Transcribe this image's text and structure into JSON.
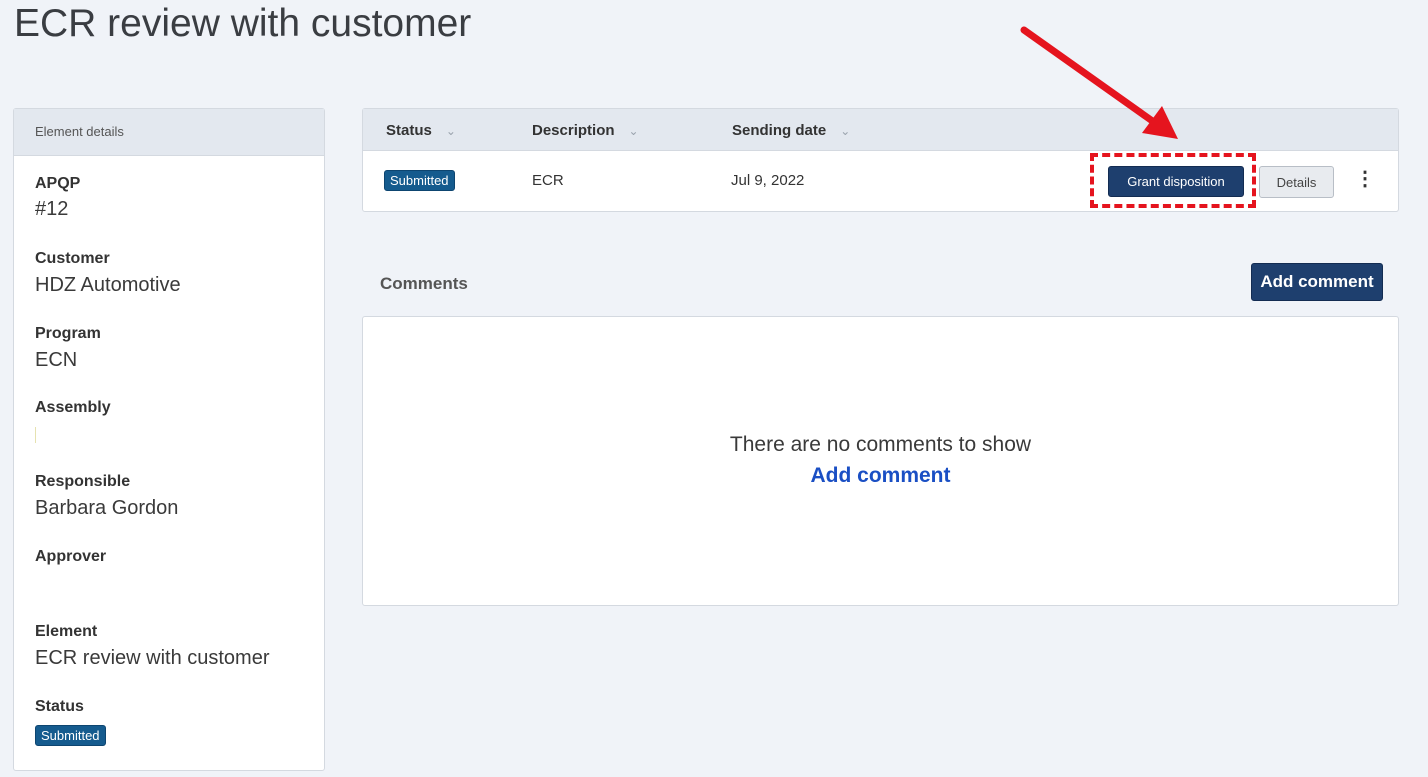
{
  "page": {
    "title": "ECR review with customer"
  },
  "details": {
    "header": "Element details",
    "apqp_label": "APQP",
    "apqp_value": "#12",
    "customer_label": "Customer",
    "customer_value": "HDZ Automotive",
    "program_label": "Program",
    "program_value": "ECN",
    "assembly_label": "Assembly",
    "responsible_label": "Responsible",
    "responsible_value": "Barbara Gordon",
    "approver_label": "Approver",
    "element_label": "Element",
    "element_value": "ECR review with customer",
    "status_label": "Status",
    "status_value": "Submitted"
  },
  "table": {
    "headers": [
      "Status",
      "Description",
      "Sending date"
    ],
    "chevron": "⌄",
    "row": {
      "status": "Submitted",
      "description": "ECR",
      "sending_date": "Jul 9, 2022",
      "grant_label": "Grant disposition",
      "details_label": "Details",
      "more_icon": "⋮"
    }
  },
  "comments": {
    "title": "Comments",
    "add_button": "Add comment",
    "empty_message": "There are no comments to show",
    "empty_link": "Add comment"
  },
  "colors": {
    "badge": "#155b8e",
    "primary_button": "#1e3f6e",
    "annotation": "#e5141e",
    "link": "#1a4fc4"
  }
}
